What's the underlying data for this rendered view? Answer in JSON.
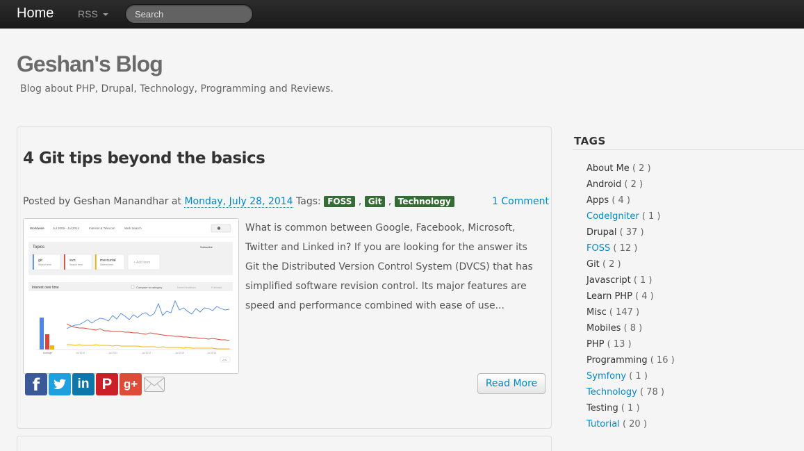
{
  "nav": {
    "home": "Home",
    "rss": "RSS",
    "search_placeholder": "Search"
  },
  "header": {
    "title": "Geshan's Blog",
    "description": "Blog about PHP, Drupal, Technology, Programming and Reviews."
  },
  "post": {
    "title": "4 Git tips beyond the basics",
    "posted_by": "Posted by Geshan Manandhar at",
    "date": "Monday, July 28, 2014",
    "tags_label": "Tags:",
    "tags": [
      "FOSS",
      "Git",
      "Technology"
    ],
    "comments": "1 Comment",
    "excerpt": "What is common between Google, Facebook, Microsoft, Twitter and Linked in? If you are looking for the answer its Git the Distributed Version Control System (DVCS) that has simplified software revision control. Its major features are speed and performance combined with ease of use...",
    "read_more": "Read More",
    "thumbnail": {
      "filter_worldwide": "Worldwide",
      "filter_dates": "Jul 2009 - Jul 2014",
      "filter_category": "Internet & Telecom",
      "filter_search": "Web Search",
      "topics_label": "Topics",
      "subscribe": "Subscribe",
      "topics": [
        "git",
        "svn",
        "mercurial"
      ],
      "topic_sub": "Search term",
      "add_term": "+ Add term",
      "interest_label": "Interest over time",
      "compare": "Compare to category",
      "news_headlines": "News headlines",
      "forecast": "Forecast",
      "average": "Average",
      "years": [
        "Jul 2010",
        "Jul 2011",
        "Jul 2012",
        "Jul 2013",
        "Jul 2014"
      ]
    },
    "share_icons": [
      "facebook-icon",
      "twitter-icon",
      "linkedin-icon",
      "pinterest-icon",
      "google-plus-icon",
      "email-icon"
    ]
  },
  "sidebar": {
    "heading": "TAGS",
    "tags": [
      {
        "name": "About Me",
        "count": "( 2 )",
        "highlight": false
      },
      {
        "name": "Android",
        "count": "( 2 )",
        "highlight": false
      },
      {
        "name": "Apps",
        "count": "( 4 )",
        "highlight": false
      },
      {
        "name": "CodeIgniter",
        "count": "( 1 )",
        "highlight": true
      },
      {
        "name": "Drupal",
        "count": "( 37 )",
        "highlight": false
      },
      {
        "name": "FOSS",
        "count": "( 12 )",
        "highlight": true
      },
      {
        "name": "Git",
        "count": "( 2 )",
        "highlight": false
      },
      {
        "name": "Javascript",
        "count": "( 1 )",
        "highlight": false
      },
      {
        "name": "Learn PHP",
        "count": "( 4 )",
        "highlight": false
      },
      {
        "name": "Misc",
        "count": "( 147 )",
        "highlight": false
      },
      {
        "name": "Mobiles",
        "count": "( 8 )",
        "highlight": false
      },
      {
        "name": "PHP",
        "count": "( 13 )",
        "highlight": false
      },
      {
        "name": "Programming",
        "count": "( 16 )",
        "highlight": false
      },
      {
        "name": "Symfony",
        "count": "( 1 )",
        "highlight": true
      },
      {
        "name": "Technology",
        "count": "( 78 )",
        "highlight": true
      },
      {
        "name": "Testing",
        "count": "( 1 )",
        "highlight": false
      },
      {
        "name": "Tutorial",
        "count": "( 20 )",
        "highlight": true
      }
    ]
  },
  "colors": {
    "navbar": "#1b1b1b",
    "link": "#0088cc",
    "tag_label": "#356b35"
  }
}
